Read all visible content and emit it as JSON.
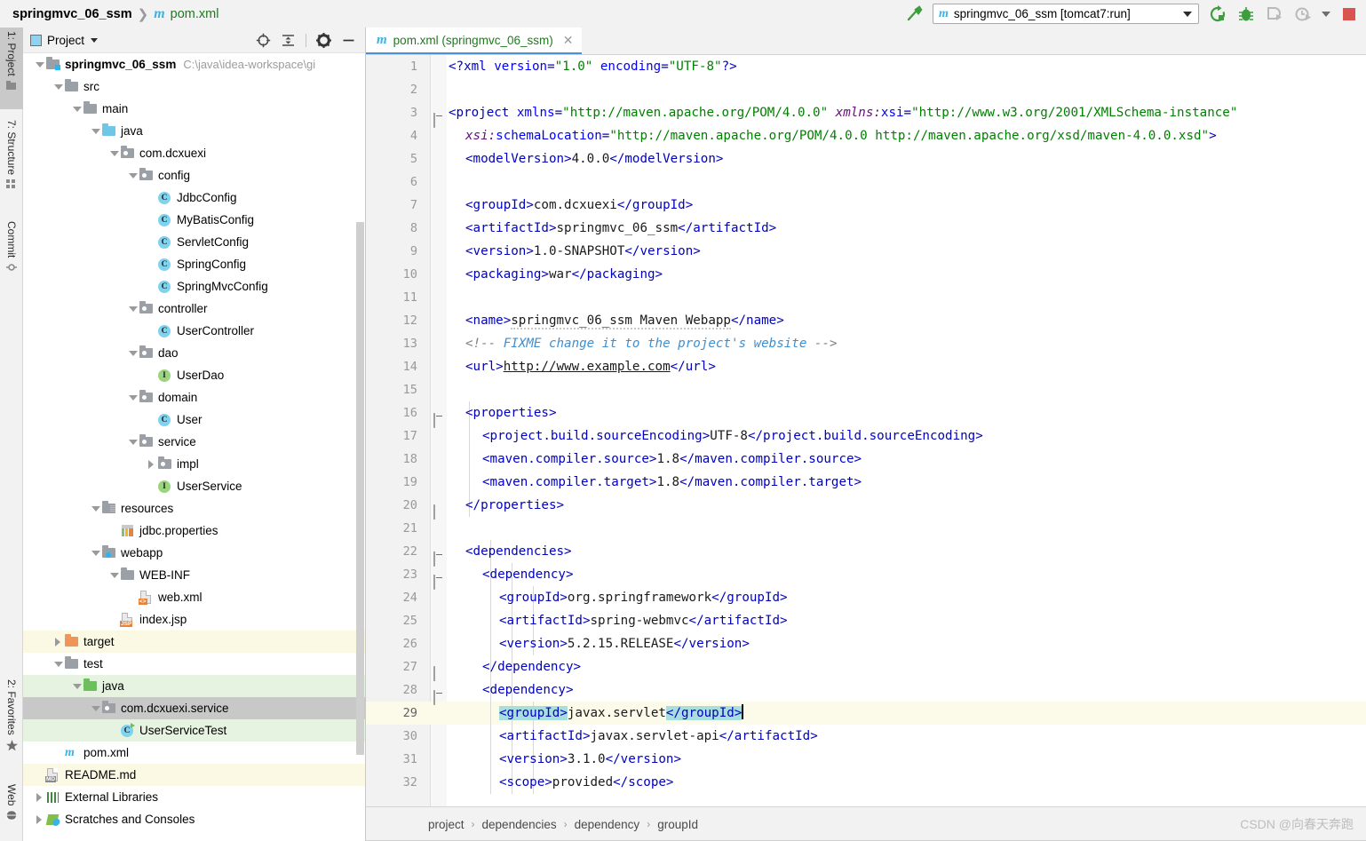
{
  "titlebar": {
    "breadcrumb": {
      "project": "springmvc_06_ssm",
      "separator": "❯",
      "file": "pom.xml",
      "file_icon": "maven-m-icon"
    },
    "build_icon": "hammer-icon",
    "run_config": {
      "label": "springmvc_06_ssm [tomcat7:run]",
      "icon": "maven-m-icon",
      "dropdown_icon": "chevron-down-icon"
    },
    "actions": [
      {
        "name": "rerun-maven-button",
        "icon": "rerun-icon"
      },
      {
        "name": "debug-button",
        "icon": "bug-icon"
      },
      {
        "name": "run-with-coverage-button",
        "icon": "coverage-icon"
      },
      {
        "name": "profiler-button",
        "icon": "profiler-icon"
      },
      {
        "name": "stop-button",
        "icon": "stop-square-icon"
      }
    ]
  },
  "left_strip": {
    "top_tabs": [
      {
        "label": "1: Project",
        "icon": "project-folder-icon",
        "active": true
      },
      {
        "label": "7: Structure",
        "icon": "structure-icon",
        "active": false
      },
      {
        "label": "Commit",
        "icon": "commit-icon",
        "active": false
      }
    ],
    "bottom_tabs": [
      {
        "label": "2: Favorites",
        "icon": "star-icon",
        "active": false
      },
      {
        "label": "Web",
        "icon": "globe-icon",
        "active": false
      }
    ]
  },
  "project_panel": {
    "header": {
      "title": "Project",
      "view_icon": "project-view-icon",
      "dropdown_icon": "chevron-down-icon",
      "actions": [
        {
          "name": "select-opened-file-button",
          "icon": "crosshair-target-icon"
        },
        {
          "name": "collapse-all-button",
          "icon": "collapse-all-icon"
        },
        {
          "name": "settings-button",
          "icon": "gear-icon"
        },
        {
          "name": "hide-panel-button",
          "icon": "minus-icon"
        }
      ]
    },
    "tree": [
      {
        "label": "springmvc_06_ssm",
        "path": "C:\\java\\idea-workspace\\gi",
        "indent": 0,
        "arrow": "down",
        "icon": "module-folder-icon",
        "bold": true,
        "highlight": "none"
      },
      {
        "label": "src",
        "indent": 1,
        "arrow": "down",
        "icon": "folder-gray-icon",
        "bold": false,
        "highlight": "none"
      },
      {
        "label": "main",
        "indent": 2,
        "arrow": "down",
        "icon": "folder-gray-icon",
        "bold": false,
        "highlight": "none"
      },
      {
        "label": "java",
        "indent": 3,
        "arrow": "down",
        "icon": "folder-blue-icon",
        "bold": false,
        "highlight": "none"
      },
      {
        "label": "com.dcxuexi",
        "indent": 4,
        "arrow": "down",
        "icon": "package-icon",
        "bold": false,
        "highlight": "none"
      },
      {
        "label": "config",
        "indent": 5,
        "arrow": "down",
        "icon": "package-icon",
        "bold": false,
        "highlight": "none"
      },
      {
        "label": "JdbcConfig",
        "indent": 6,
        "arrow": "none",
        "icon": "java-class-icon",
        "bold": false,
        "highlight": "none"
      },
      {
        "label": "MyBatisConfig",
        "indent": 6,
        "arrow": "none",
        "icon": "java-class-icon",
        "bold": false,
        "highlight": "none"
      },
      {
        "label": "ServletConfig",
        "indent": 6,
        "arrow": "none",
        "icon": "java-class-icon",
        "bold": false,
        "highlight": "none"
      },
      {
        "label": "SpringConfig",
        "indent": 6,
        "arrow": "none",
        "icon": "java-class-icon",
        "bold": false,
        "highlight": "none"
      },
      {
        "label": "SpringMvcConfig",
        "indent": 6,
        "arrow": "none",
        "icon": "java-class-icon",
        "bold": false,
        "highlight": "none"
      },
      {
        "label": "controller",
        "indent": 5,
        "arrow": "down",
        "icon": "package-icon",
        "bold": false,
        "highlight": "none"
      },
      {
        "label": "UserController",
        "indent": 6,
        "arrow": "none",
        "icon": "java-class-icon",
        "bold": false,
        "highlight": "none"
      },
      {
        "label": "dao",
        "indent": 5,
        "arrow": "down",
        "icon": "package-icon",
        "bold": false,
        "highlight": "none"
      },
      {
        "label": "UserDao",
        "indent": 6,
        "arrow": "none",
        "icon": "java-interface-icon",
        "bold": false,
        "highlight": "none"
      },
      {
        "label": "domain",
        "indent": 5,
        "arrow": "down",
        "icon": "package-icon",
        "bold": false,
        "highlight": "none"
      },
      {
        "label": "User",
        "indent": 6,
        "arrow": "none",
        "icon": "java-class-icon",
        "bold": false,
        "highlight": "none"
      },
      {
        "label": "service",
        "indent": 5,
        "arrow": "down",
        "icon": "package-icon",
        "bold": false,
        "highlight": "none"
      },
      {
        "label": "impl",
        "indent": 6,
        "arrow": "right",
        "icon": "package-icon",
        "bold": false,
        "highlight": "none"
      },
      {
        "label": "UserService",
        "indent": 6,
        "arrow": "none",
        "icon": "java-interface-icon",
        "bold": false,
        "highlight": "none"
      },
      {
        "label": "resources",
        "indent": 3,
        "arrow": "down",
        "icon": "resources-folder-icon",
        "bold": false,
        "highlight": "none"
      },
      {
        "label": "jdbc.properties",
        "indent": 4,
        "arrow": "none",
        "icon": "properties-file-icon",
        "bold": false,
        "highlight": "none"
      },
      {
        "label": "webapp",
        "indent": 3,
        "arrow": "down",
        "icon": "webapp-folder-icon",
        "bold": false,
        "highlight": "none"
      },
      {
        "label": "WEB-INF",
        "indent": 4,
        "arrow": "down",
        "icon": "folder-gray-icon",
        "bold": false,
        "highlight": "none"
      },
      {
        "label": "web.xml",
        "indent": 5,
        "arrow": "none",
        "icon": "web-xml-icon",
        "bold": false,
        "highlight": "none"
      },
      {
        "label": "index.jsp",
        "indent": 4,
        "arrow": "none",
        "icon": "jsp-file-icon",
        "bold": false,
        "highlight": "none"
      },
      {
        "label": "target",
        "indent": 1,
        "arrow": "right",
        "icon": "folder-orange-icon",
        "bold": false,
        "highlight": "yellow"
      },
      {
        "label": "test",
        "indent": 1,
        "arrow": "down",
        "icon": "folder-gray-icon",
        "bold": false,
        "highlight": "none"
      },
      {
        "label": "java",
        "indent": 2,
        "arrow": "down",
        "icon": "folder-green-icon",
        "bold": false,
        "highlight": "green"
      },
      {
        "label": "com.dcxuexi.service",
        "indent": 3,
        "arrow": "down",
        "icon": "package-icon",
        "bold": false,
        "highlight": "selected"
      },
      {
        "label": "UserServiceTest",
        "indent": 4,
        "arrow": "none",
        "icon": "java-test-class-icon",
        "bold": false,
        "highlight": "green"
      },
      {
        "label": "pom.xml",
        "indent": 1,
        "arrow": "none",
        "icon": "maven-m-icon",
        "bold": false,
        "highlight": "none"
      },
      {
        "label": "README.md",
        "indent": 0,
        "arrow": "none",
        "icon": "markdown-file-icon",
        "bold": false,
        "highlight": "yellow"
      },
      {
        "label": "External Libraries",
        "indent": 0,
        "arrow": "right",
        "icon": "libraries-icon",
        "bold": false,
        "highlight": "none"
      },
      {
        "label": "Scratches and Consoles",
        "indent": 0,
        "arrow": "right",
        "icon": "scratches-icon",
        "bold": false,
        "highlight": "none"
      }
    ]
  },
  "editor": {
    "tab": {
      "label": "pom.xml (springmvc_06_ssm)",
      "icon": "maven-m-icon",
      "close_icon": "close-icon"
    },
    "lines": [
      {
        "n": "1",
        "fold": "none",
        "current": false
      },
      {
        "n": "2",
        "fold": "none",
        "current": false
      },
      {
        "n": "3",
        "fold": "open",
        "current": false
      },
      {
        "n": "4",
        "fold": "none",
        "current": false
      },
      {
        "n": "5",
        "fold": "none",
        "current": false
      },
      {
        "n": "6",
        "fold": "none",
        "current": false
      },
      {
        "n": "7",
        "fold": "none",
        "current": false
      },
      {
        "n": "8",
        "fold": "none",
        "current": false
      },
      {
        "n": "9",
        "fold": "none",
        "current": false
      },
      {
        "n": "10",
        "fold": "none",
        "current": false
      },
      {
        "n": "11",
        "fold": "none",
        "current": false
      },
      {
        "n": "12",
        "fold": "none",
        "current": false
      },
      {
        "n": "13",
        "fold": "none",
        "current": false
      },
      {
        "n": "14",
        "fold": "none",
        "current": false
      },
      {
        "n": "15",
        "fold": "none",
        "current": false
      },
      {
        "n": "16",
        "fold": "open",
        "current": false
      },
      {
        "n": "17",
        "fold": "none",
        "current": false
      },
      {
        "n": "18",
        "fold": "none",
        "current": false
      },
      {
        "n": "19",
        "fold": "none",
        "current": false
      },
      {
        "n": "20",
        "fold": "close",
        "current": false
      },
      {
        "n": "21",
        "fold": "none",
        "current": false
      },
      {
        "n": "22",
        "fold": "open",
        "current": false
      },
      {
        "n": "23",
        "fold": "open",
        "current": false
      },
      {
        "n": "24",
        "fold": "none",
        "current": false
      },
      {
        "n": "25",
        "fold": "none",
        "current": false
      },
      {
        "n": "26",
        "fold": "none",
        "current": false
      },
      {
        "n": "27",
        "fold": "close",
        "current": false
      },
      {
        "n": "28",
        "fold": "open",
        "current": false
      },
      {
        "n": "29",
        "fold": "none",
        "current": true
      },
      {
        "n": "30",
        "fold": "none",
        "current": false
      },
      {
        "n": "31",
        "fold": "none",
        "current": false
      },
      {
        "n": "32",
        "fold": "none",
        "current": false
      }
    ],
    "code_text": {
      "l1": "<?xml version=\"1.0\" encoding=\"UTF-8\"?>",
      "l3": "<project xmlns=\"http://maven.apache.org/POM/4.0.0\" xmlns:xsi=\"http://www.w3.org/2001/XMLSchema-instance\"",
      "l4": "xsi:schemaLocation=\"http://maven.apache.org/POM/4.0.0 http://maven.apache.org/xsd/maven-4.0.0.xsd\">",
      "l5": "<modelVersion>4.0.0</modelVersion>",
      "l7": "<groupId>com.dcxuexi</groupId>",
      "l8": "<artifactId>springmvc_06_ssm</artifactId>",
      "l9": "<version>1.0-SNAPSHOT</version>",
      "l10": "<packaging>war</packaging>",
      "l12": "<name>springmvc_06_ssm Maven Webapp</name>",
      "l13": "<!-- FIXME change it to the project's website -->",
      "l14": "<url>http://www.example.com</url>",
      "l16": "<properties>",
      "l17": "<project.build.sourceEncoding>UTF-8</project.build.sourceEncoding>",
      "l18": "<maven.compiler.source>1.8</maven.compiler.source>",
      "l19": "<maven.compiler.target>1.8</maven.compiler.target>",
      "l20": "</properties>",
      "l22": "<dependencies>",
      "l23": "<dependency>",
      "l24": "<groupId>org.springframework</groupId>",
      "l25": "<artifactId>spring-webmvc</artifactId>",
      "l26": "<version>5.2.15.RELEASE</version>",
      "l27": "</dependency>",
      "l28": "<dependency>",
      "l29": "<groupId>javax.servlet</groupId>",
      "l30": "<artifactId>javax.servlet-api</artifactId>",
      "l31": "<version>3.1.0</version>",
      "l32": "<scope>provided</scope>"
    }
  },
  "bottom_breadcrumb": {
    "items": [
      "project",
      "dependencies",
      "dependency",
      "groupId"
    ],
    "separator": "›"
  },
  "watermark": "CSDN @向春天奔跑",
  "colors": {
    "accent_blue": "#4a90d9",
    "maven_icon": "#3ab3e6",
    "string_green": "#008000",
    "tag_blue": "#0000c0",
    "selection_highlight": "#a8dede",
    "current_line": "#fcfae8",
    "tree_selected": "#c8c8c8",
    "tree_green": "#e6f3e1",
    "tree_yellow": "#fbf9e3",
    "stop_red": "#d9534f",
    "run_green": "#3c9e3c"
  }
}
